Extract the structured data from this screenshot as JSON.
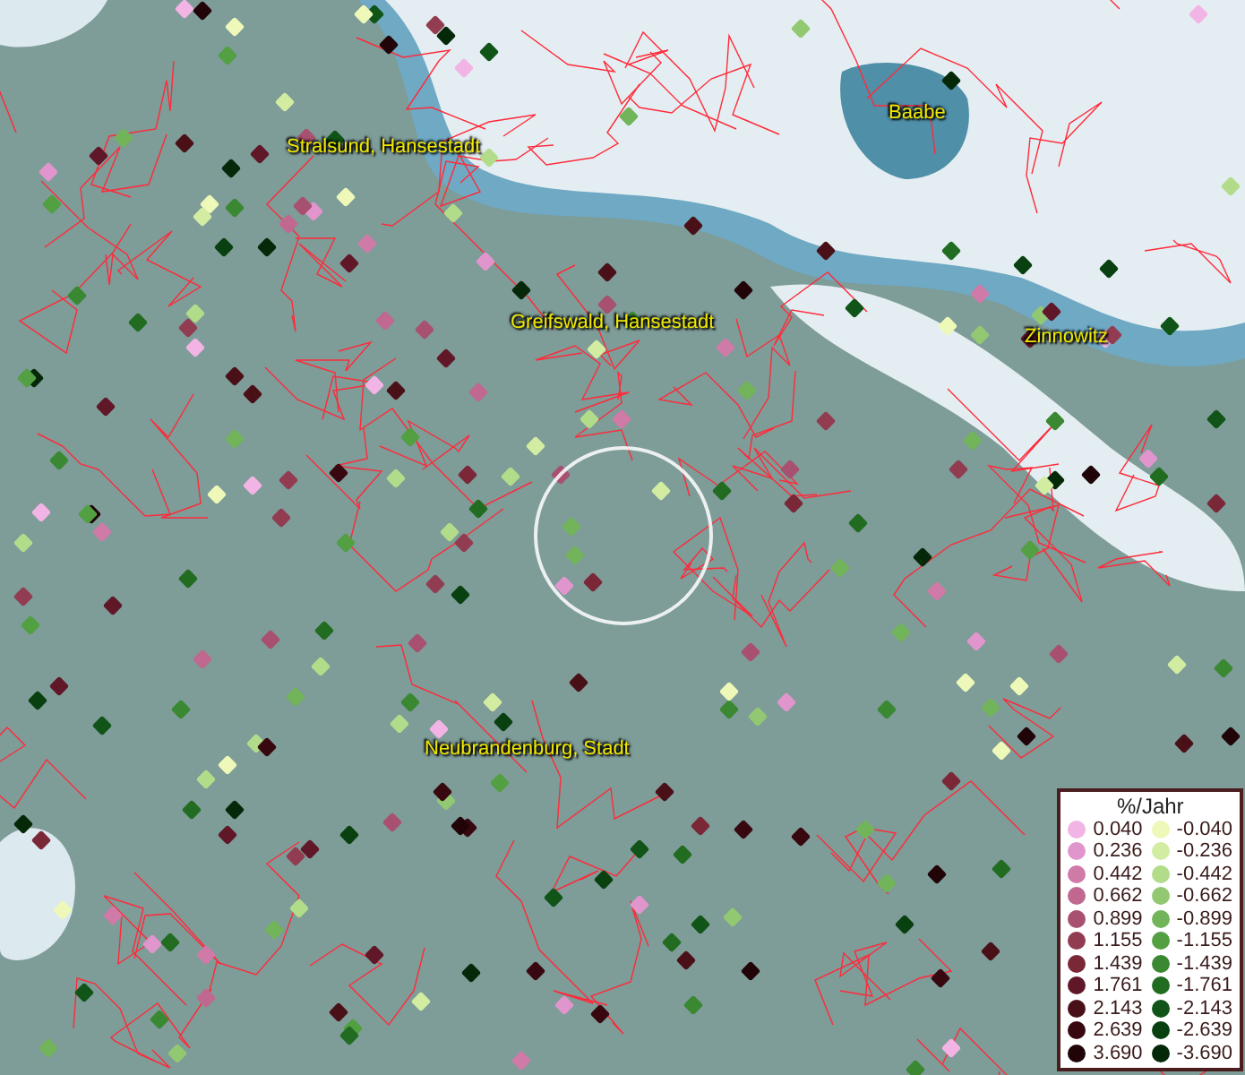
{
  "map": {
    "places": [
      {
        "name": "Stralsund, Hansestadt"
      },
      {
        "name": "Baabe"
      },
      {
        "name": "Greifswald, Hansestadt"
      },
      {
        "name": "Zinnowitz"
      },
      {
        "name": "Neubrandenburg, Stadt"
      }
    ]
  },
  "legend": {
    "title": "%/Jahr",
    "entries": [
      {
        "value": "0.040",
        "color": "#f2b4e4"
      },
      {
        "value": "-0.040",
        "color": "#eef8b8"
      },
      {
        "value": "0.236",
        "color": "#e096cc"
      },
      {
        "value": "-0.236",
        "color": "#d2eca2"
      },
      {
        "value": "0.442",
        "color": "#d07aa8"
      },
      {
        "value": "-0.442",
        "color": "#b2dc8a"
      },
      {
        "value": "0.662",
        "color": "#c06890"
      },
      {
        "value": "-0.662",
        "color": "#92c872"
      },
      {
        "value": "0.899",
        "color": "#a85070"
      },
      {
        "value": "-0.899",
        "color": "#72b45a"
      },
      {
        "value": "1.155",
        "color": "#923c52"
      },
      {
        "value": "-1.155",
        "color": "#52a042"
      },
      {
        "value": "1.439",
        "color": "#7a2838"
      },
      {
        "value": "-1.439",
        "color": "#3a8832"
      },
      {
        "value": "1.761",
        "color": "#601828"
      },
      {
        "value": "-1.761",
        "color": "#226c22"
      },
      {
        "value": "2.143",
        "color": "#4a1018"
      },
      {
        "value": "-2.143",
        "color": "#105418"
      },
      {
        "value": "2.639",
        "color": "#380810"
      },
      {
        "value": "-2.639",
        "color": "#084010"
      },
      {
        "value": "3.690",
        "color": "#200408"
      },
      {
        "value": "-3.690",
        "color": "#042808"
      }
    ]
  }
}
